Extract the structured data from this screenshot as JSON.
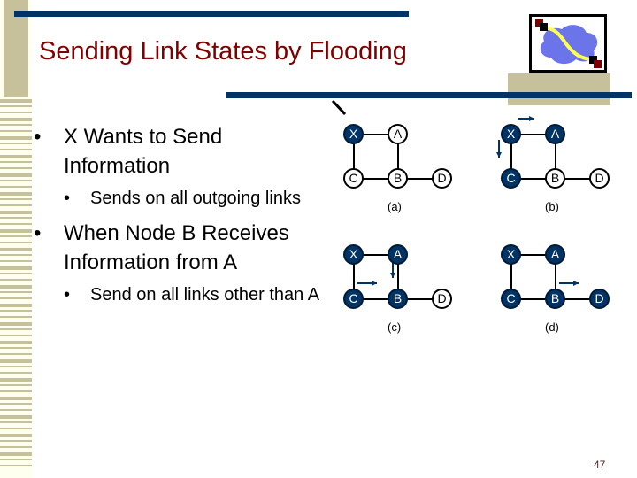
{
  "slide": {
    "title": "Sending Link States by Flooding",
    "page_number": "47",
    "colors": {
      "title": "#800000",
      "rule": "#003366",
      "accent": "#c6c19a",
      "node_on": "#003366"
    }
  },
  "bullets": [
    {
      "level": 1,
      "text": "X Wants to Send Information"
    },
    {
      "level": 2,
      "text": "Sends on all outgoing links"
    },
    {
      "level": 1,
      "text": "When Node B Receives Information from A"
    },
    {
      "level": 2,
      "text": "Send on all links other than A"
    }
  ],
  "panels": [
    {
      "caption": "(a)",
      "nodes": {
        "X": "on",
        "A": "off",
        "C": "off",
        "B": "off",
        "D": "off"
      }
    },
    {
      "caption": "(b)",
      "nodes": {
        "X": "on",
        "A": "on",
        "C": "on",
        "B": "off",
        "D": "off"
      }
    },
    {
      "caption": "(c)",
      "nodes": {
        "X": "on",
        "A": "on",
        "C": "on",
        "B": "on",
        "D": "off"
      }
    },
    {
      "caption": "(d)",
      "nodes": {
        "X": "on",
        "A": "on",
        "C": "on",
        "B": "on",
        "D": "on"
      }
    }
  ],
  "node_labels": {
    "X": "X",
    "A": "A",
    "C": "C",
    "B": "B",
    "D": "D"
  }
}
